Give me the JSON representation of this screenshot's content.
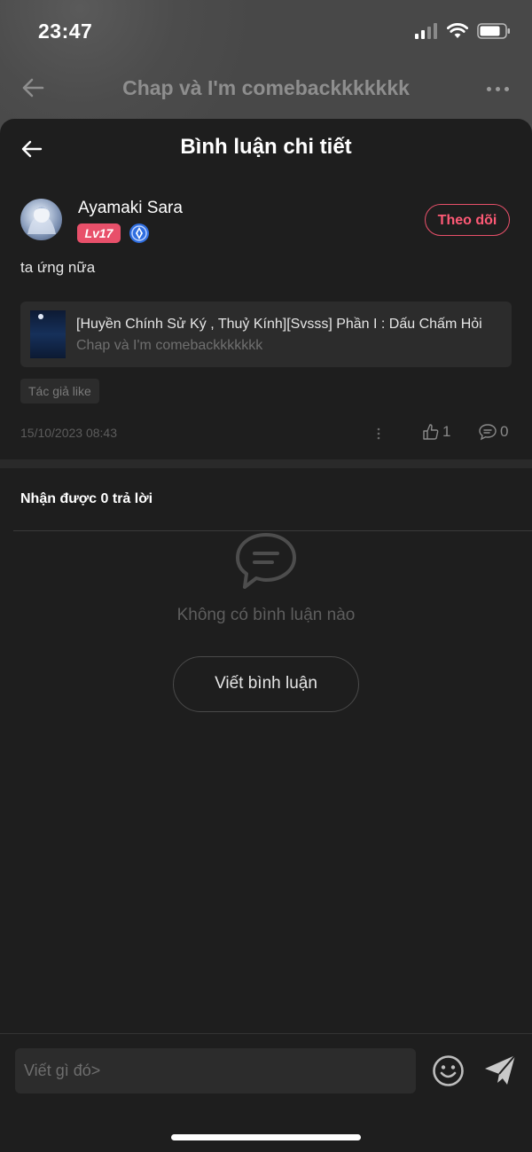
{
  "status_bar": {
    "time": "23:47"
  },
  "background_header": {
    "title": "Chap và I'm comebackkkkkkk"
  },
  "sheet": {
    "title": "Bình luận chi tiết",
    "comment": {
      "username": "Ayamaki Sara",
      "level": "Lv17",
      "follow_label": "Theo dõi",
      "text": "ta ứng nữa",
      "story": {
        "title": "[Huyền Chính Sử Ký , Thuỷ Kính][Svsss] Phần I : Dấu Chấm Hỏi",
        "chapter": "Chap và I'm comebackkkkkkk"
      },
      "tag": "Tác giả like",
      "timestamp": "15/10/2023 08:43",
      "likes": "1",
      "replies": "0"
    },
    "replies_heading": "Nhận được 0 trả lời",
    "empty_text": "Không có bình luận nào",
    "write_button": "Viết bình luận",
    "input_placeholder": "Viết gì đó>"
  },
  "colors": {
    "accent": "#e8506a",
    "sheet_bg": "#1e1e1e",
    "overlay_bg": "#4a4a4a"
  }
}
